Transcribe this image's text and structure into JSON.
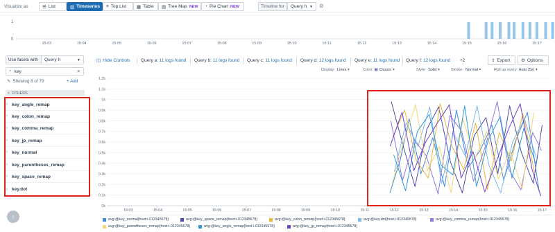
{
  "toolbar": {
    "visualize_as": "Visualize as",
    "buttons": [
      {
        "label": "List",
        "icon": "list-icon",
        "active": false
      },
      {
        "label": "Timeseries",
        "icon": "timeseries-icon",
        "active": true
      },
      {
        "label": "Top List",
        "icon": "toplist-icon",
        "active": false
      },
      {
        "label": "Table",
        "icon": "table-icon",
        "active": false
      },
      {
        "label": "Tree Map",
        "icon": "treemap-icon",
        "active": false,
        "badge": "NEW"
      },
      {
        "label": "Pie Chart",
        "icon": "piechart-icon",
        "active": false,
        "badge": "NEW"
      }
    ],
    "timeline_for": "Timeline for",
    "timeline_query": "Query h"
  },
  "timeline": {
    "y_ticks": [
      "1",
      "0"
    ],
    "x_ticks": [
      "15:03",
      "15:04",
      "15:05",
      "15:06",
      "15:07",
      "15:08",
      "15:09",
      "15:10",
      "15:11",
      "15:12",
      "15:13",
      "15:14",
      "15:15",
      "15:16",
      "15:17"
    ],
    "bar_minutes": [
      15.05,
      15.55,
      15.72,
      15.95,
      16.2,
      16.35,
      16.6,
      16.8,
      17.0,
      17.25,
      17.45,
      17.65,
      17.9,
      18.15,
      18.35,
      18.6,
      18.8
    ],
    "bar_color": "#93c6ea"
  },
  "sidebar": {
    "facets_label": "Use facets with",
    "facets_query": "Query h",
    "search_value": "key",
    "showing": "Showing 8 of 79",
    "add": "Add",
    "group": "OTHERS",
    "items": [
      "key_angle_remap",
      "key_colon_remap",
      "key_comma_remap",
      "key_jp_remap",
      "key_normal",
      "key_parentheses_remap",
      "key_space_remap",
      "key.dot"
    ]
  },
  "header": {
    "hide_controls": "Hide Controls",
    "queries": [
      {
        "name": "Query a:",
        "found": "11 logs found"
      },
      {
        "name": "Query b:",
        "found": "11 logs found"
      },
      {
        "name": "Query c:",
        "found": "11 logs found"
      },
      {
        "name": "Query d:",
        "found": "12 logs found"
      },
      {
        "name": "Query e:",
        "found": "11 logs found"
      },
      {
        "name": "Query f:",
        "found": "12 logs found"
      }
    ],
    "more": "+2",
    "export": "Export",
    "options": "Options"
  },
  "display_options": {
    "display_label": "Display:",
    "display_value": "Lines",
    "color_label": "Color:",
    "color_value": "Classic",
    "style_label": "Style:",
    "style_value": "Solid",
    "stroke_label": "Stroke:",
    "stroke_value": "Normal",
    "rollup_label": "Roll up every:",
    "rollup_value": "Auto (5s)"
  },
  "chart_data": {
    "type": "line",
    "x_ticks": [
      "15:03",
      "15:04",
      "15:05",
      "15:06",
      "15:07",
      "15:08",
      "15:09",
      "15:10",
      "15:11",
      "15:12",
      "15:13",
      "15:14",
      "15:15",
      "15:16",
      "15:17"
    ],
    "y_ticks": [
      "1.2k",
      "1.1k",
      "1k",
      "0.9k",
      "0.8k",
      "0.7k",
      "0.6k",
      "0.5k",
      "0.4k",
      "0.3k",
      "0.2k",
      "0.1k",
      "0k"
    ],
    "ylim": [
      0,
      1200
    ],
    "xlim_minutes": [
      2.3,
      17.2
    ],
    "series": [
      {
        "name": "avg:@key_normal{host:i-012345678}",
        "color": "#3f8ae0",
        "x": [
          11.85,
          12.2,
          12.5,
          12.9,
          13.3,
          13.7,
          14.1,
          14.5,
          14.9,
          15.3,
          15.7,
          16.1,
          16.5,
          16.9
        ],
        "values": [
          120,
          430,
          820,
          300,
          640,
          180,
          900,
          360,
          520,
          760,
          240,
          610,
          880,
          130
        ]
      },
      {
        "name": "avg:@key_space_remap{host:i-012345678}",
        "color": "#4d4ea8",
        "x": [
          11.9,
          12.3,
          12.7,
          13.1,
          13.5,
          13.9,
          14.3,
          14.7,
          15.1,
          15.5,
          15.9,
          16.3,
          16.7,
          17.0
        ],
        "values": [
          980,
          560,
          180,
          720,
          930,
          410,
          120,
          660,
          830,
          300,
          940,
          500,
          210,
          760
        ]
      },
      {
        "name": "avg:@key_colon_remap{host:i-012345678}",
        "color": "#eab53c",
        "x": [
          11.95,
          12.35,
          12.75,
          13.15,
          13.55,
          13.95,
          14.35,
          14.75,
          15.15,
          15.55,
          15.95,
          16.35,
          16.75
        ],
        "values": [
          650,
          900,
          420,
          260,
          960,
          560,
          340,
          780,
          150,
          690,
          420,
          870,
          300
        ]
      },
      {
        "name": "avg:@key.dot{host:i-012345678}",
        "color": "#7fb6ee",
        "x": [
          12.0,
          12.4,
          12.8,
          13.2,
          13.6,
          14.0,
          14.4,
          14.8,
          15.2,
          15.6,
          16.0,
          16.4,
          16.8
        ],
        "values": [
          320,
          780,
          560,
          930,
          210,
          680,
          470,
          940,
          380,
          120,
          600,
          820,
          450
        ]
      },
      {
        "name": "avg:@key_comma_remap{host:i-012345678}",
        "color": "#8b7ae0",
        "x": [
          11.88,
          12.28,
          12.68,
          13.08,
          13.48,
          13.88,
          14.28,
          14.68,
          15.08,
          15.48,
          15.88,
          16.28,
          16.68,
          16.98
        ],
        "values": [
          800,
          240,
          620,
          470,
          110,
          850,
          700,
          230,
          560,
          980,
          340,
          150,
          690,
          520
        ]
      },
      {
        "name": "avg:@key_parentheses_remap{host:i-012345678}",
        "color": "#f5d67a",
        "x": [
          11.92,
          12.32,
          12.72,
          13.12,
          13.52,
          13.92,
          14.32,
          14.72,
          15.12,
          15.52,
          15.92,
          16.32,
          16.72
        ],
        "values": [
          200,
          610,
          950,
          330,
          560,
          120,
          820,
          440,
          700,
          250,
          520,
          160,
          880
        ]
      },
      {
        "name": "avg:@key_angle_remap{host:i-012345678}",
        "color": "#2f9bd6",
        "x": [
          11.98,
          12.38,
          12.78,
          13.18,
          13.58,
          13.98,
          14.38,
          14.78,
          15.18,
          15.58,
          15.98,
          16.38,
          16.78
        ],
        "values": [
          480,
          140,
          700,
          860,
          380,
          290,
          940,
          180,
          620,
          840,
          260,
          730,
          400
        ]
      },
      {
        "name": "avg:@key_jp_remap{host:i-012345678}",
        "color": "#6e3fc7",
        "x": [
          11.86,
          12.26,
          12.66,
          13.06,
          13.46,
          13.86,
          14.26,
          14.66,
          15.06,
          15.46,
          15.86,
          16.26,
          16.66,
          16.96
        ],
        "values": [
          560,
          880,
          330,
          600,
          780,
          950,
          260,
          510,
          130,
          420,
          720,
          960,
          340,
          90
        ]
      }
    ]
  }
}
